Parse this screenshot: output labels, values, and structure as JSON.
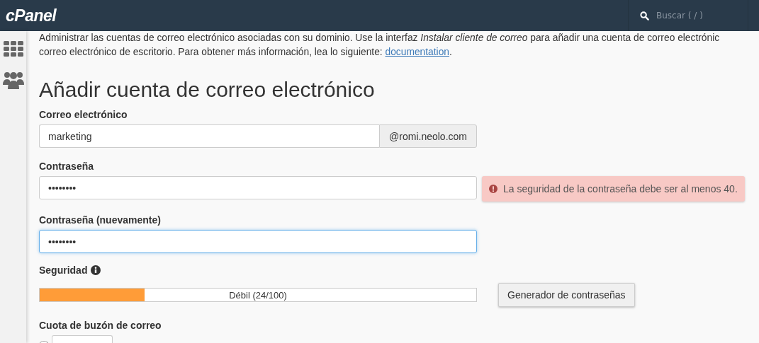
{
  "header": {
    "logo": "cPanel",
    "search": {
      "placeholder": "Buscar ( / )"
    }
  },
  "intro": {
    "line_1": "Administrar las cuentas de correo electrónico asociadas con su dominio. Use la interfaz *Instalar cliente de correo* para añadir una cuenta de correo electrónic",
    "line_2": "correo electrónico de escritorio. Para obtener más información, lea lo siguiente: ",
    "link": "documentation",
    "end": "."
  },
  "title": "Añadir cuenta de correo electrónico",
  "email": {
    "label": "Correo electrónico",
    "value": "marketing",
    "domain": "@romi.neolo.com"
  },
  "password": {
    "label": "Contraseña",
    "value": "••••••••",
    "focused": false,
    "error": "La seguridad de la contraseña debe ser al menos 40."
  },
  "password_again": {
    "label": "Contraseña (nuevamente)",
    "value": "••••••••",
    "focused": true
  },
  "strength": {
    "label": "Seguridad",
    "level": 0.24,
    "reading": "Débil (24/100)",
    "button": "Generador de contraseñas"
  },
  "quota": {
    "label": "Cuota de buzón de correo",
    "custom_selected": false
  }
}
